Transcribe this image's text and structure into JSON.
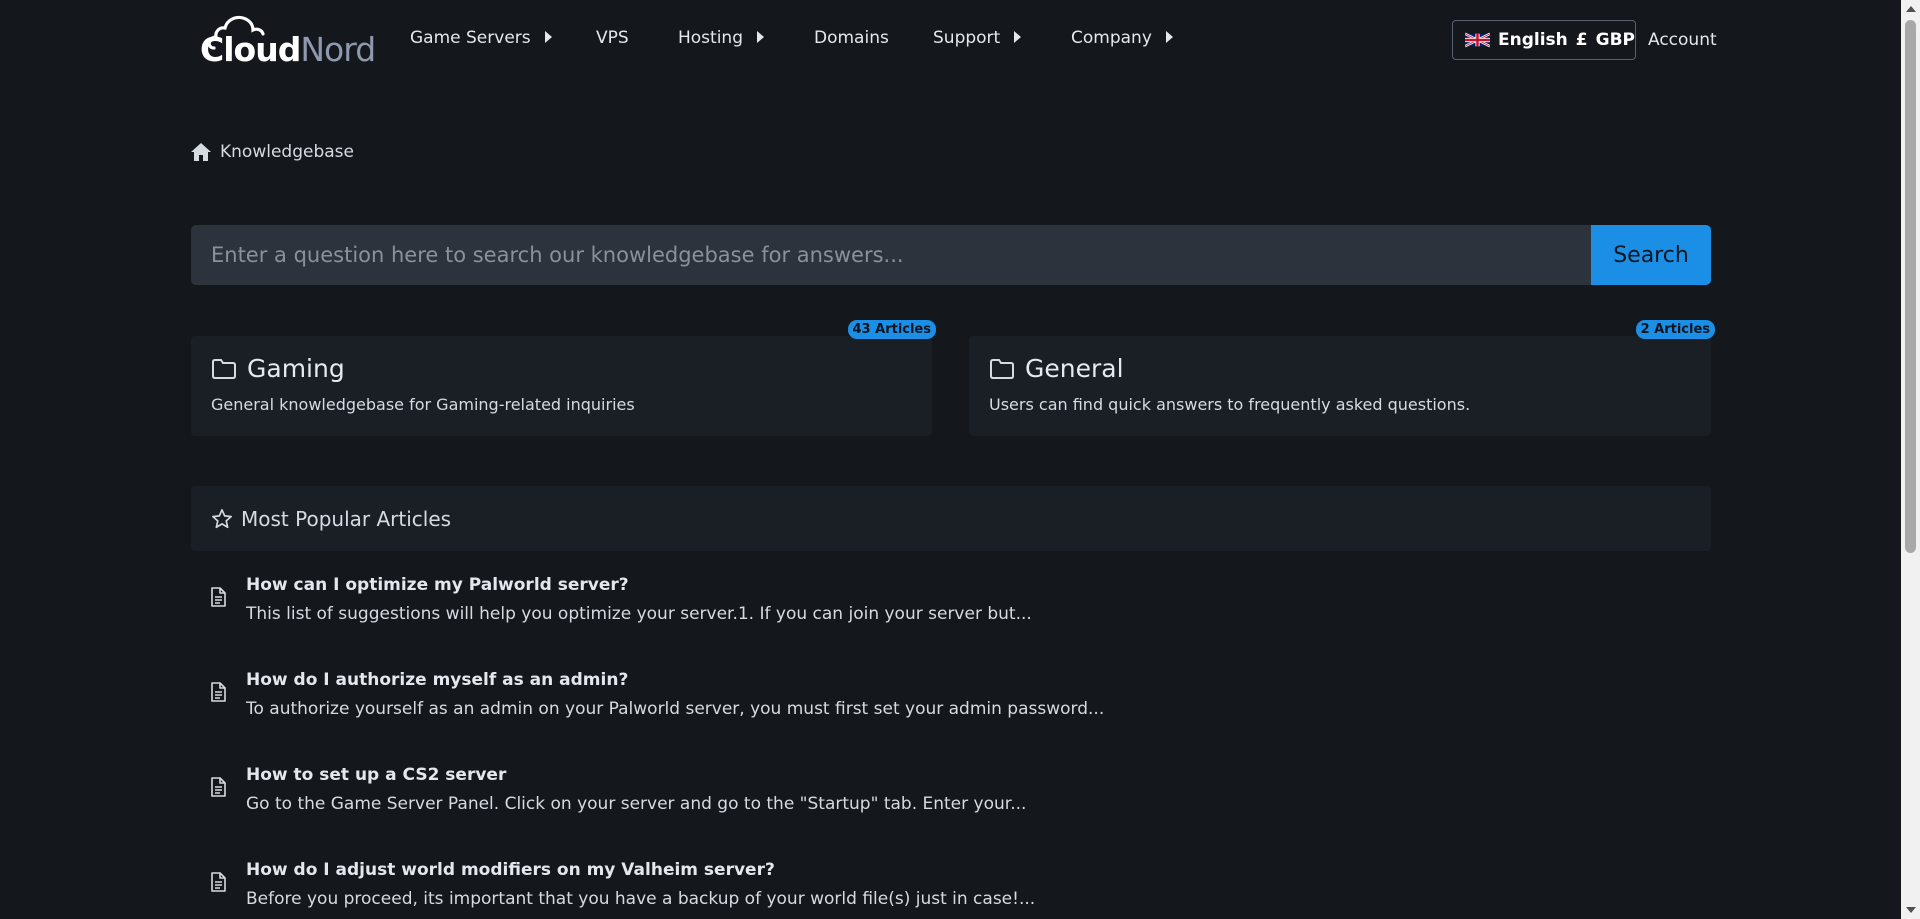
{
  "brand": {
    "logo_part1": "Cloud",
    "logo_part2": "Nord",
    "logo_icon": "cloud-logo"
  },
  "nav": {
    "items": [
      {
        "label": "Game Servers",
        "has_submenu": true
      },
      {
        "label": "VPS",
        "has_submenu": false
      },
      {
        "label": "Hosting",
        "has_submenu": true
      },
      {
        "label": "Domains",
        "has_submenu": false
      },
      {
        "label": "Support",
        "has_submenu": true
      },
      {
        "label": "Company",
        "has_submenu": true
      }
    ],
    "language_label": "English",
    "currency_symbol": "£",
    "currency_code": "GBP",
    "flag_icon": "uk-flag-icon",
    "account_label": "Account"
  },
  "breadcrumb": {
    "icon": "home-icon",
    "label": "Knowledgebase"
  },
  "search": {
    "placeholder": "Enter a question here to search our knowledgebase for answers...",
    "value": "",
    "button_label": "Search"
  },
  "categories": [
    {
      "title": "Gaming",
      "description": "General knowledgebase for Gaming-related inquiries",
      "badge": "43 Articles",
      "icon": "folder-icon"
    },
    {
      "title": "General",
      "description": "Users can find quick answers to frequently asked questions.",
      "badge": "2 Articles",
      "icon": "folder-icon"
    }
  ],
  "popular": {
    "heading": "Most Popular Articles",
    "icon": "star-icon",
    "articles": [
      {
        "title": "How can I optimize my Palworld server?",
        "excerpt": "This list of suggestions will help you optimize your server.1. If you can join your server but..."
      },
      {
        "title": "How do I authorize myself as an admin?",
        "excerpt": "To authorize yourself as an admin on your Palworld server, you must first set your admin password..."
      },
      {
        "title": "How to set up a CS2 server",
        "excerpt": "Go to the Game Server Panel. Click on your server and go to the \"Startup\" tab. Enter your..."
      },
      {
        "title": "How do I adjust world modifiers on my Valheim server?",
        "excerpt": "Before you proceed, its important that you have a backup of your world file(s) just in case!..."
      }
    ]
  },
  "colors": {
    "background": "#14171c",
    "card": "#1a1e25",
    "accent": "#1b8ee6",
    "input": "#2d333d"
  }
}
